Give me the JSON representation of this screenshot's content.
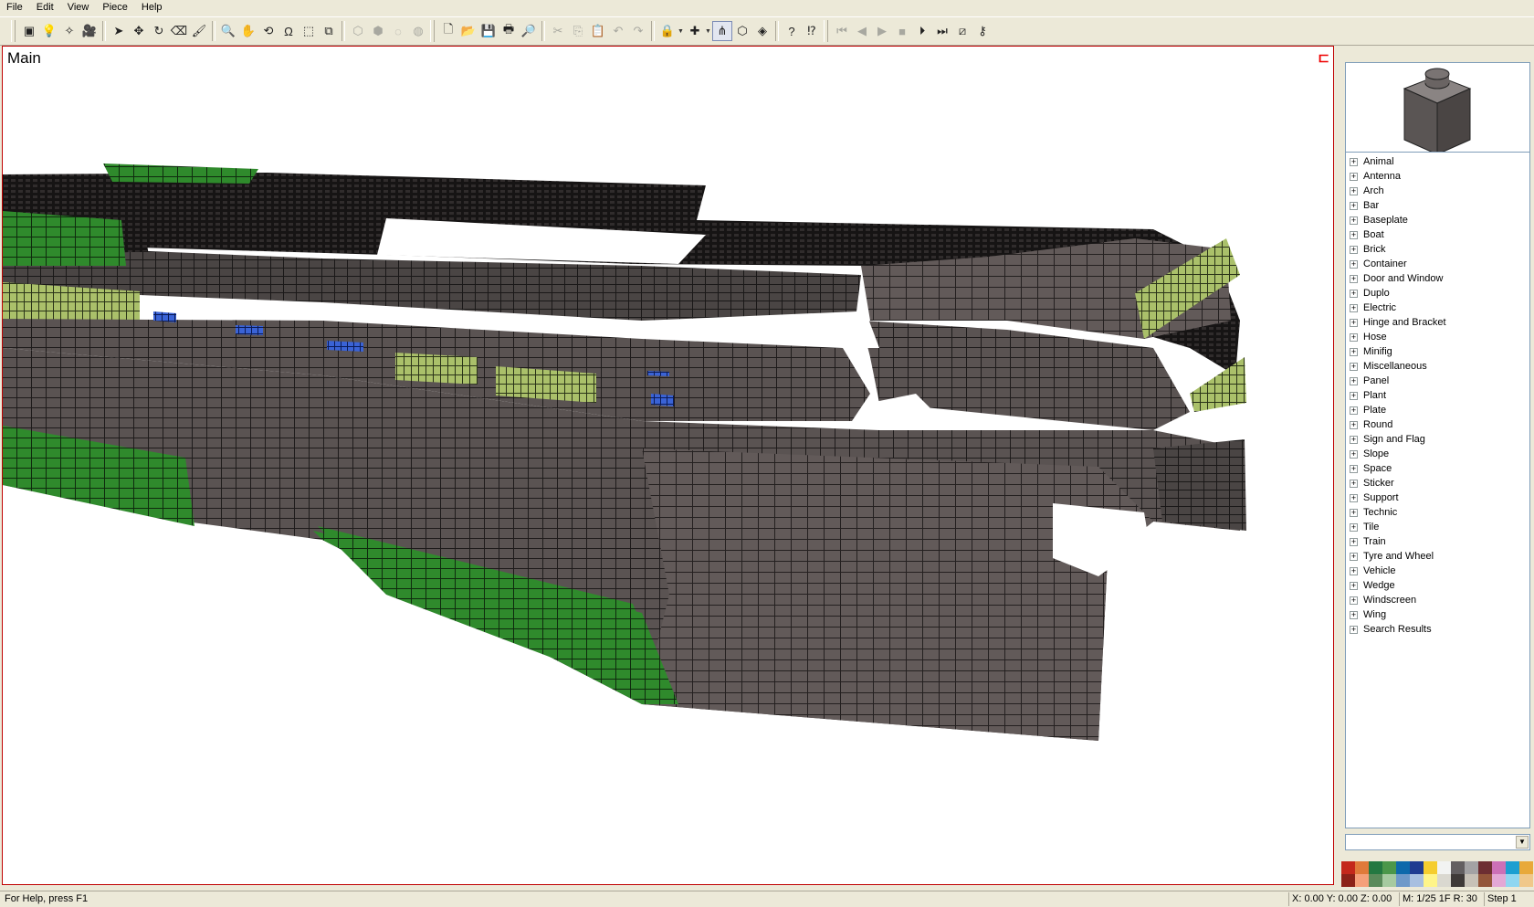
{
  "menu": [
    "File",
    "Edit",
    "View",
    "Piece",
    "Help"
  ],
  "toolbar": {
    "buttons": [
      {
        "name": "insert-piece-icon",
        "glyph": "▣",
        "dis": false
      },
      {
        "name": "light-icon",
        "glyph": "💡",
        "dis": false
      },
      {
        "name": "spotlight-icon",
        "glyph": "✧",
        "dis": false
      },
      {
        "name": "camera-icon",
        "glyph": "🎥",
        "dis": false
      },
      {
        "sep": true
      },
      {
        "name": "select-icon",
        "glyph": "➤",
        "dis": false
      },
      {
        "name": "move-icon",
        "glyph": "✥",
        "dis": false
      },
      {
        "name": "rotate-icon",
        "glyph": "↻",
        "dis": false
      },
      {
        "name": "eraser-icon",
        "glyph": "⌫",
        "dis": false
      },
      {
        "name": "paint-icon",
        "glyph": "🖌",
        "dis": false
      },
      {
        "sep": true
      },
      {
        "name": "zoom-icon",
        "glyph": "🔍",
        "dis": false
      },
      {
        "name": "pan-icon",
        "glyph": "✋",
        "dis": false
      },
      {
        "name": "rotate-view-icon",
        "glyph": "⟲",
        "dis": false
      },
      {
        "name": "roll-icon",
        "glyph": "Ω",
        "dis": false
      },
      {
        "name": "zoom-region-icon",
        "glyph": "⬚",
        "dis": false
      },
      {
        "name": "zoom-extents-icon",
        "glyph": "⧉",
        "dis": false
      },
      {
        "sep": true
      },
      {
        "name": "group-icon",
        "glyph": "⬡",
        "dis": true
      },
      {
        "name": "ungroup-icon",
        "glyph": "⬢",
        "dis": true
      },
      {
        "name": "hide-icon",
        "glyph": "◌",
        "dis": true
      },
      {
        "name": "unhide-icon",
        "glyph": "◍",
        "dis": true
      },
      {
        "grip": true
      },
      {
        "name": "new-file-icon",
        "glyph": "🗋",
        "dis": false
      },
      {
        "name": "open-file-icon",
        "glyph": "📂",
        "dis": false
      },
      {
        "name": "save-file-icon",
        "glyph": "💾",
        "dis": false
      },
      {
        "name": "print-icon",
        "glyph": "🖶",
        "dis": false
      },
      {
        "name": "print-preview-icon",
        "glyph": "🔎",
        "dis": false
      },
      {
        "sep": true
      },
      {
        "name": "cut-icon",
        "glyph": "✂",
        "dis": true
      },
      {
        "name": "copy-icon",
        "glyph": "⎘",
        "dis": true
      },
      {
        "name": "paste-icon",
        "glyph": "📋",
        "dis": true
      },
      {
        "name": "undo-icon",
        "glyph": "↶",
        "dis": true
      },
      {
        "name": "redo-icon",
        "glyph": "↷",
        "dis": true
      },
      {
        "sep": true
      },
      {
        "name": "snap-icon",
        "glyph": "🔒",
        "dis": false,
        "drop": true
      },
      {
        "name": "snap-grid-icon",
        "glyph": "✚",
        "dis": false,
        "drop": true
      },
      {
        "name": "snap-magnet-icon",
        "glyph": "⋔",
        "dis": false,
        "on": true
      },
      {
        "name": "perspective-icon",
        "glyph": "⬡",
        "dis": false
      },
      {
        "name": "shading-icon",
        "glyph": "◈",
        "dis": false
      },
      {
        "sep": true
      },
      {
        "name": "help-icon",
        "glyph": "?",
        "dis": false
      },
      {
        "name": "whats-this-icon",
        "glyph": "⁉",
        "dis": false
      },
      {
        "grip": true
      },
      {
        "name": "first-step-icon",
        "glyph": "⏮",
        "dis": true
      },
      {
        "name": "previous-step-icon",
        "glyph": "◀",
        "dis": true
      },
      {
        "name": "play-icon",
        "glyph": "▶",
        "dis": true
      },
      {
        "name": "stop-icon",
        "glyph": "■",
        "dis": true
      },
      {
        "name": "next-step-icon",
        "glyph": "⏵",
        "dis": false
      },
      {
        "name": "last-step-icon",
        "glyph": "⏭",
        "dis": false
      },
      {
        "name": "insert-step-icon",
        "glyph": "⧄",
        "dis": false
      },
      {
        "name": "key-icon",
        "glyph": "⚷",
        "dis": false
      }
    ]
  },
  "viewport": {
    "label": "Main",
    "corner": "⊏"
  },
  "categories": [
    "Animal",
    "Antenna",
    "Arch",
    "Bar",
    "Baseplate",
    "Boat",
    "Brick",
    "Container",
    "Door and Window",
    "Duplo",
    "Electric",
    "Hinge and Bracket",
    "Hose",
    "Minifig",
    "Miscellaneous",
    "Panel",
    "Plant",
    "Plate",
    "Round",
    "Sign and Flag",
    "Slope",
    "Space",
    "Sticker",
    "Support",
    "Technic",
    "Tile",
    "Train",
    "Tyre and Wheel",
    "Vehicle",
    "Wedge",
    "Windscreen",
    "Wing",
    "Search Results"
  ],
  "tree_expand_glyph": "+",
  "combo_value": "",
  "palette": [
    "#c4281b",
    "#e07a3a",
    "#237841",
    "#4b974a",
    "#0d69ab",
    "#1f3b91",
    "#f5cd2f",
    "#f2f3f2",
    "#635f61",
    "#a3a2a4",
    "#6d2e32",
    "#cc70b7",
    "#1b9fd1",
    "#e8a93a",
    "#8c2218",
    "#f5a07a",
    "#5a8a5a",
    "#a6caa0",
    "#6e99c9",
    "#a8bfe0",
    "#fff58a",
    "#dad8d0",
    "#3f3a38",
    "#c7c1b7",
    "#94563a",
    "#e3a8d5",
    "#8fd6f0",
    "#f0c88a"
  ],
  "status": {
    "help": "For Help, press F1",
    "coords": "X: 0.00 Y: 0.00 Z: 0.00",
    "snap": "M: 1/25 1F R: 30",
    "step": "Step 1"
  }
}
